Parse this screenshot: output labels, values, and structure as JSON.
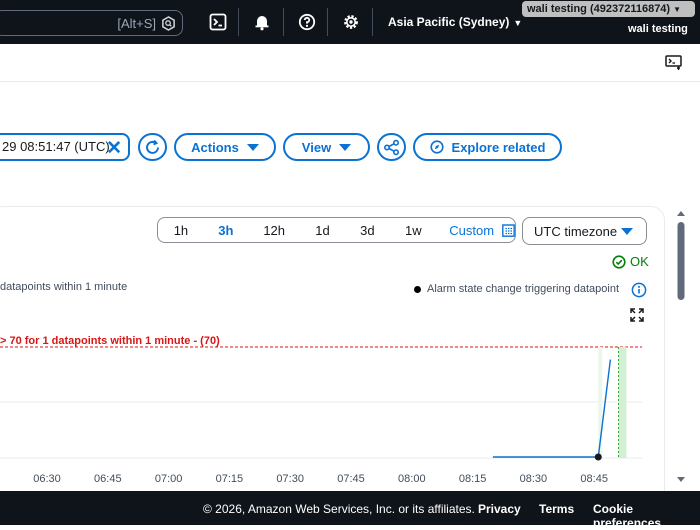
{
  "topnav": {
    "search_shortcut": "[Alt+S]",
    "region": "Asia Pacific (Sydney)",
    "account": "wali testing (492372116874)",
    "user": "wali testing"
  },
  "toolbar": {
    "date_value": "29 08:51:47 (UTC)",
    "actions_label": "Actions",
    "view_label": "View",
    "explore_label": "Explore related"
  },
  "graph": {
    "ranges": [
      "1h",
      "3h",
      "12h",
      "1d",
      "3d",
      "1w"
    ],
    "selected_range": "3h",
    "custom_label": "Custom",
    "timezone": "UTC timezone",
    "status": "OK",
    "description": "datapoints within 1 minute",
    "legend": "Alarm state change triggering datapoint",
    "threshold_label": "> 70 for 1 datapoints within 1 minute - (70)",
    "x_ticks": [
      "06:30",
      "06:45",
      "07:00",
      "07:15",
      "07:30",
      "07:45",
      "08:00",
      "08:15",
      "08:30",
      "08:45"
    ]
  },
  "chart_data": {
    "type": "line",
    "x": [
      "08:20",
      "08:32",
      "08:46",
      "08:49"
    ],
    "series": [
      {
        "values": [
          0,
          0,
          0,
          62
        ]
      }
    ],
    "threshold": 70,
    "x_ticks": [
      "06:30",
      "06:45",
      "07:00",
      "07:15",
      "07:30",
      "07:45",
      "08:00",
      "08:15",
      "08:30",
      "08:45"
    ]
  },
  "footer": {
    "copyright": "© 2026, Amazon Web Services, Inc. or its affiliates.",
    "privacy": "Privacy",
    "terms": "Terms",
    "cookies": "Cookie preferences"
  }
}
